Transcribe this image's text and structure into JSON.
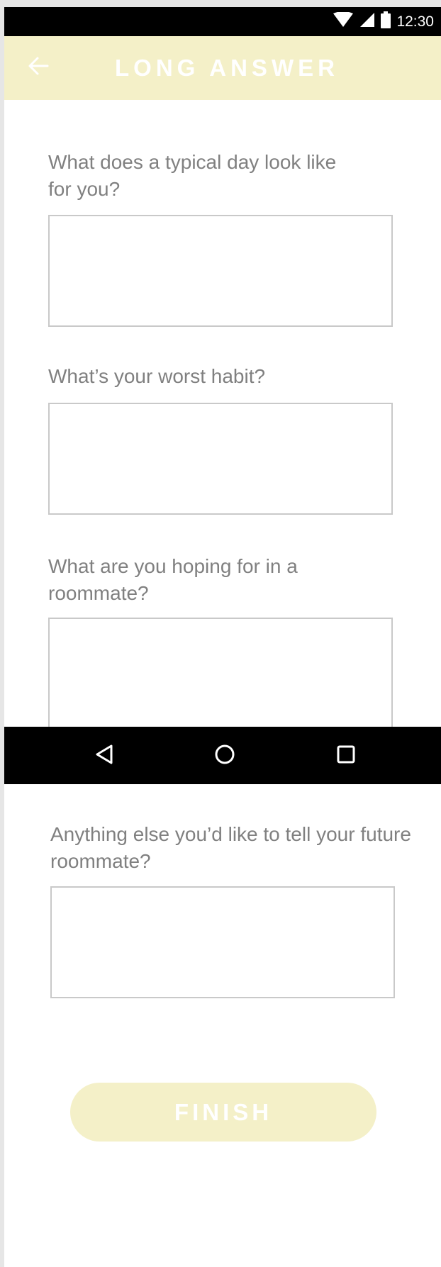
{
  "status_bar": {
    "time": "12:30",
    "icons": [
      "wifi-icon",
      "cell-signal-icon",
      "battery-icon"
    ],
    "background": "#000000"
  },
  "app_bar": {
    "title": "LONG ANSWER",
    "back_icon": "arrow-left-icon",
    "background": "#f4f0c8",
    "title_color": "#ffffff"
  },
  "form": {
    "questions": [
      {
        "label": "What does a typical day look like for you?",
        "value": "",
        "placeholder": ""
      },
      {
        "label": "What’s your worst habit?",
        "value": "",
        "placeholder": ""
      },
      {
        "label": "What are you hoping for in a roommate?",
        "value": "",
        "placeholder": ""
      },
      {
        "label": "Anything else you’d like to tell your future roommate?",
        "value": "",
        "placeholder": ""
      }
    ],
    "label_color": "#808080",
    "box_border_color": "#c9c9c9"
  },
  "nav_bar": {
    "buttons": [
      "triangle-back-icon",
      "circle-home-icon",
      "square-recents-icon"
    ],
    "background": "#000000"
  },
  "finish_button": {
    "label": "FINISH",
    "background": "#f4f0c8",
    "text_color": "#ffffff"
  }
}
